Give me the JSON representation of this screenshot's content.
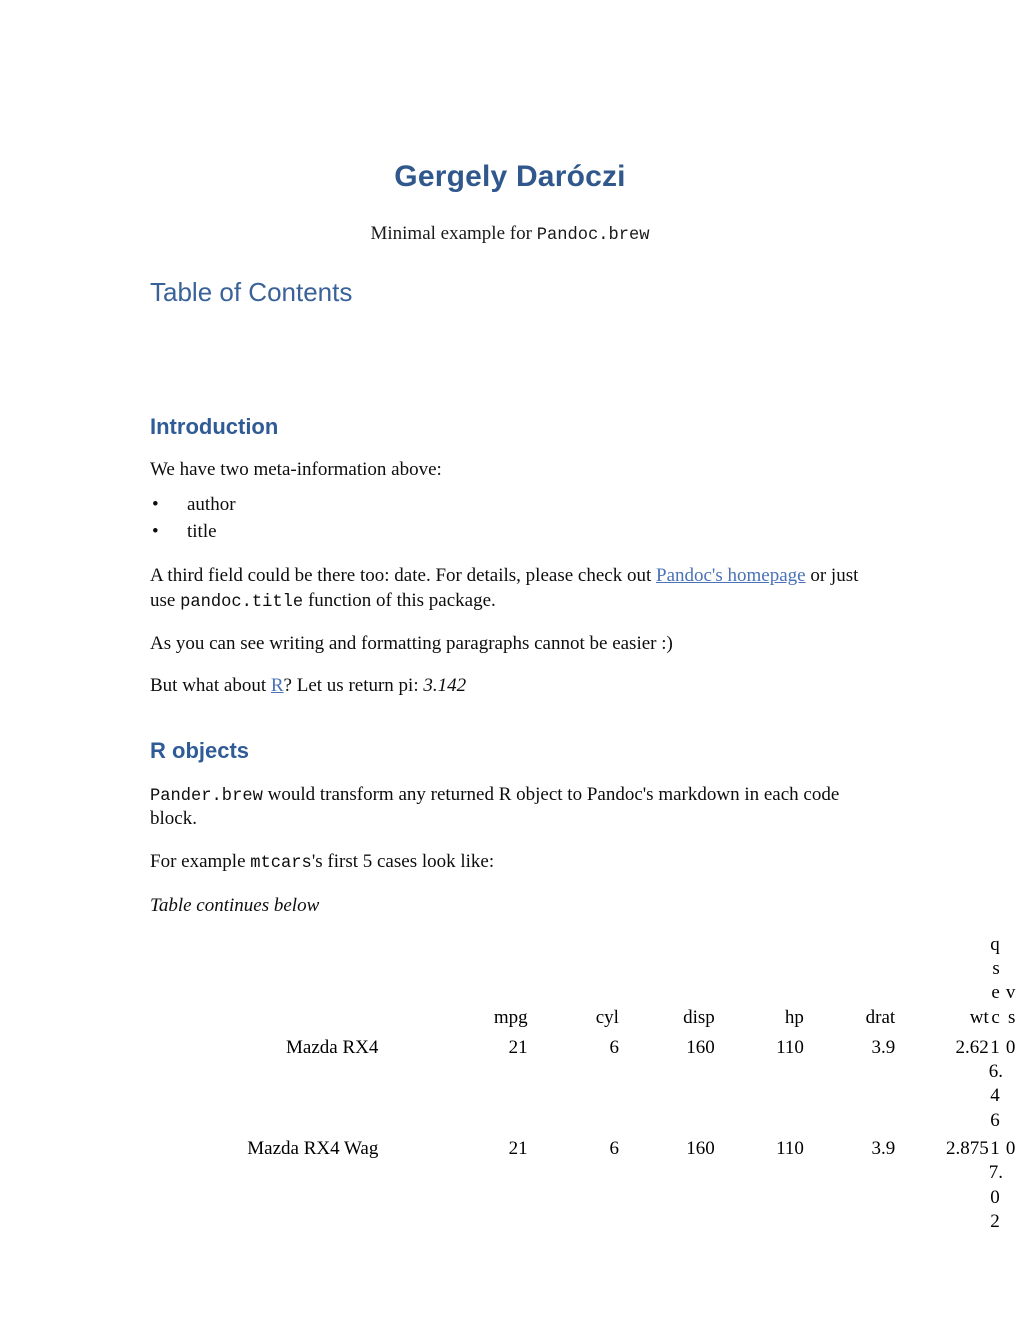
{
  "document": {
    "title": "Gergely Daróczi",
    "subtitle_prefix": "Minimal example for ",
    "subtitle_code": "Pandoc.brew",
    "heading_color": "#2F5B96",
    "title_color": "#31588C",
    "link_color": "#4A72B8"
  },
  "toc": {
    "heading": "Table of Contents",
    "entries": []
  },
  "introduction": {
    "heading": "Introduction",
    "intro_paragraph": "We have two meta-information above:",
    "bullet_glyph": "•",
    "items": [
      {
        "label": "author"
      },
      {
        "label": "title"
      }
    ],
    "para2_part1": "A third field could be there too: date. For details, please check out ",
    "para2_link": "Pandoc's homepage",
    "para2_part2": " or just use ",
    "para2_code": "pandoc.title",
    "para2_part3": " function of this package.",
    "para3": "As you can see writing and formatting paragraphs cannot be easier :)",
    "para4_part1": "But what about ",
    "para4_link": "R",
    "para4_part2": "? Let us return pi: ",
    "para4_italic": "3.142"
  },
  "r_objects": {
    "heading": "R objects",
    "para1_code": "Pander.brew",
    "para1_text": " would transform any returned R object to Pandoc's markdown in each code block.",
    "para2_part1": "For example ",
    "para2_code": "mtcars",
    "para2_part2": "'s first 5 cases look like:",
    "continuation_note": "Table continues below"
  },
  "table": {
    "row_label_header": "",
    "columns": [
      "mpg",
      "cyl",
      "disp",
      "hp",
      "drat",
      "wt",
      "qsec",
      "vs"
    ],
    "rows": [
      {
        "name": "Mazda RX4",
        "mpg": "21",
        "cyl": "6",
        "disp": "160",
        "hp": "110",
        "drat": "3.9",
        "wt": "2.62",
        "qsec": "16.46",
        "vs": "0"
      },
      {
        "name": "Mazda RX4 Wag",
        "mpg": "21",
        "cyl": "6",
        "disp": "160",
        "hp": "110",
        "drat": "3.9",
        "wt": "2.875",
        "qsec": "17.02",
        "vs": "0"
      }
    ]
  }
}
